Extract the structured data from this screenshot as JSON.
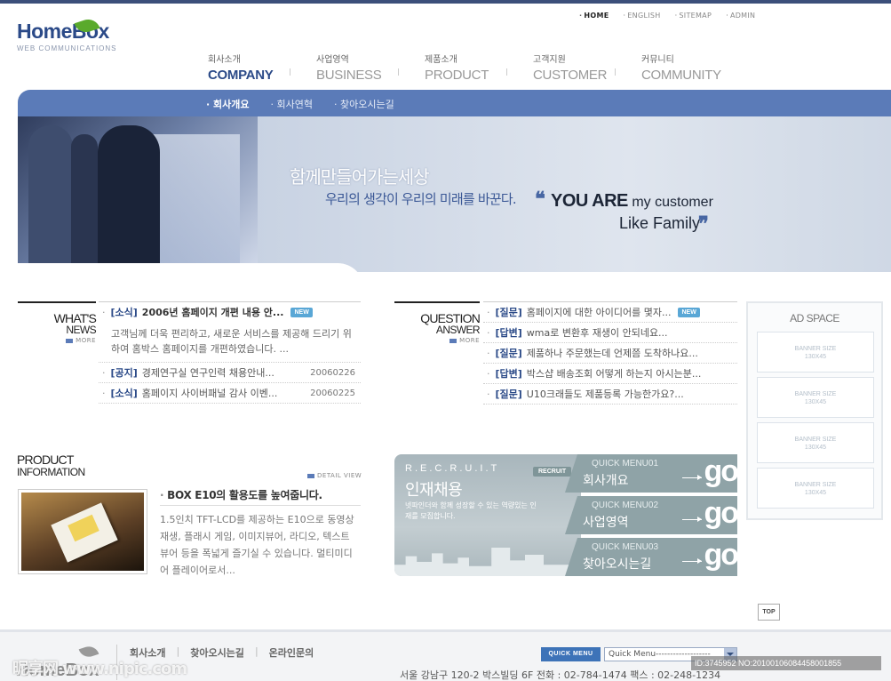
{
  "util": {
    "home": "HOME",
    "english": "ENGLISH",
    "sitemap": "SITEMAP",
    "admin": "ADMIN"
  },
  "logo": {
    "name": "HomeBox",
    "sub": "WEB COMMUNICATIONS"
  },
  "nav": [
    {
      "ko": "회사소개",
      "en": "COMPANY"
    },
    {
      "ko": "사업영역",
      "en": "BUSINESS"
    },
    {
      "ko": "제품소개",
      "en": "PRODUCT"
    },
    {
      "ko": "고객지원",
      "en": "CUSTOMER"
    },
    {
      "ko": "커뮤니티",
      "en": "COMMUNITY"
    }
  ],
  "subnav": [
    "회사개요",
    "회사연혁",
    "찾아오시는길"
  ],
  "hero": {
    "line1": "함께만들어가는세상",
    "line2": "우리의 생각이 우리의 미래를 바꾼다.",
    "quote_open": "❝",
    "you_are": "YOU ARE",
    "my_customer": " my customer",
    "like_family": "Like Family",
    "quote_close": "❞"
  },
  "news": {
    "title_a": "WHAT'S",
    "title_b": "NEWS",
    "more": "MORE",
    "badge": "NEW",
    "headline_cat": "[소식]",
    "headline": "2006년 홈페이지 개편 내용 안...",
    "desc": "고객님께 더욱 편리하고, 새로운 서비스를 제공해 드리기 위하여 홈박스 홈페이지를 개편하였습니다. ...",
    "items": [
      {
        "cat": "[공지]",
        "text": "경제연구실 연구인력 채용안내...",
        "date": "20060226"
      },
      {
        "cat": "[소식]",
        "text": "홈페이지 사이버패널 감사 이벤...",
        "date": "20060225"
      }
    ]
  },
  "qa": {
    "title_a": "QUESTION",
    "title_b": "ANSWER",
    "more": "MORE",
    "badge": "NEW",
    "items": [
      {
        "cat": "[질문]",
        "text": "홈페이지에 대한 아이디어를 몇자..."
      },
      {
        "cat": "[답변]",
        "text": "wma로 변환후 재생이 안되네요..."
      },
      {
        "cat": "[질문]",
        "text": "제품하나 주문했는데 언제쯤 도착하나요..."
      },
      {
        "cat": "[답변]",
        "text": "박스샵 배송조회 어떻게 하는지 아시는분..."
      },
      {
        "cat": "[질문]",
        "text": "U10크래들도 제품등록 가능한가요?..."
      }
    ]
  },
  "product": {
    "title_a": "PRODUCT",
    "title_b": "INFORMATION",
    "detail": "DETAIL VIEW",
    "headline": "BOX E10의 활용도를 높여줍니다.",
    "desc": "1.5인치 TFT-LCD를 제공하는 E10으로 동영상 재생, 플래시 게임, 이미지뷰어, 라디오, 텍스트 뷰어 등을 폭넓게 즐기실 수 있습니다. 멀티미디어 플레이어로서..."
  },
  "recruit": {
    "en": "R.E.C.R.U.I.T",
    "title": "인재채용",
    "desc": "넷파인더와 함께 성장할 수 있는 역량있는 인재를 모집합니다.",
    "button": "RECRUIT"
  },
  "quick": [
    {
      "label": "QUICK MENU01",
      "title": "회사개요",
      "go": "go"
    },
    {
      "label": "QUICK MENU02",
      "title": "사업영역",
      "go": "go"
    },
    {
      "label": "QUICK MENU03",
      "title": "찾아오시는길",
      "go": "go"
    }
  ],
  "ad": {
    "title": "AD SPACE",
    "banners": [
      {
        "l1": "BANNER SIZE",
        "l2": "130X45"
      },
      {
        "l1": "BANNER SIZE",
        "l2": "130X45"
      },
      {
        "l1": "BANNER SIZE",
        "l2": "130X45"
      },
      {
        "l1": "BANNER SIZE",
        "l2": "130X45"
      }
    ]
  },
  "top_button": "TOP",
  "footer": {
    "logo": "HomeBox",
    "links": [
      "회사소개",
      "찾아오시는길",
      "온라인문의"
    ],
    "quick_btn": "QUICK MENU",
    "quick_select": "Quick Menu-------------------",
    "address": "서울 강남구 120-2 박스빌딩 6F    전화 : 02-784-1474    팩스 : 02-248-1234"
  },
  "watermark": {
    "left": "昵享网 www.nipic.com",
    "right": "ID:3745952 NO:20100106084458001855"
  }
}
